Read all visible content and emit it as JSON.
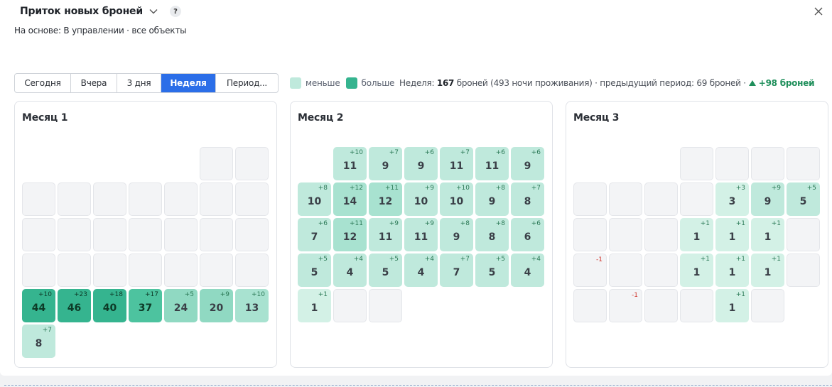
{
  "header": {
    "title": "Приток новых броней",
    "help_label": "?",
    "subtitle": "На основе: В управлении · все объекты"
  },
  "periods": [
    "Сегодня",
    "Вчера",
    "3 дня",
    "Неделя",
    "Период..."
  ],
  "active_period": "Неделя",
  "legend": {
    "less_label": "меньше",
    "more_label": "больше"
  },
  "summary": {
    "prefix": "Неделя: ",
    "bookings": "167",
    "bookings_suffix": " броней (493 ночи проживания) · предыдущий период: 69 броней ·",
    "growth": "+98 броней"
  },
  "colors": {
    "accent": "#2b6ee8",
    "scale": [
      "#d3f1e6",
      "#bfe9dc",
      "#a8e2d0",
      "#90d9c2",
      "#6fcfb0",
      "#4dc39f",
      "#35b48f"
    ],
    "negative": "#d0352d",
    "positive": "#1f8f5b"
  },
  "months": [
    {
      "title": "Месяц 1",
      "cells": [
        null,
        null,
        null,
        null,
        null,
        {
          "e": true
        },
        {
          "e": true
        },
        {
          "e": true
        },
        {
          "e": true
        },
        {
          "e": true
        },
        {
          "e": true
        },
        {
          "e": true
        },
        {
          "e": true
        },
        {
          "e": true
        },
        {
          "e": true
        },
        {
          "e": true
        },
        {
          "e": true
        },
        {
          "e": true
        },
        {
          "e": true
        },
        {
          "e": true
        },
        {
          "e": true
        },
        {
          "e": true
        },
        {
          "e": true
        },
        {
          "e": true
        },
        {
          "e": true
        },
        {
          "e": true
        },
        {
          "e": true
        },
        {
          "e": true
        },
        {
          "v": 44,
          "d": "+10"
        },
        {
          "v": 46,
          "d": "+23"
        },
        {
          "v": 40,
          "d": "+18"
        },
        {
          "v": 37,
          "d": "+17"
        },
        {
          "v": 24,
          "d": "+5"
        },
        {
          "v": 20,
          "d": "+9"
        },
        {
          "v": 13,
          "d": "+10"
        },
        {
          "v": 8,
          "d": "+7"
        }
      ]
    },
    {
      "title": "Месяц 2",
      "cells": [
        null,
        {
          "v": 11,
          "d": "+10"
        },
        {
          "v": 9,
          "d": "+7"
        },
        {
          "v": 9,
          "d": "+6"
        },
        {
          "v": 11,
          "d": "+7"
        },
        {
          "v": 11,
          "d": "+6"
        },
        {
          "v": 9,
          "d": "+6"
        },
        {
          "v": 10,
          "d": "+8"
        },
        {
          "v": 14,
          "d": "+12"
        },
        {
          "v": 12,
          "d": "+11"
        },
        {
          "v": 10,
          "d": "+9"
        },
        {
          "v": 10,
          "d": "+10"
        },
        {
          "v": 9,
          "d": "+8"
        },
        {
          "v": 8,
          "d": "+7"
        },
        {
          "v": 7,
          "d": "+6"
        },
        {
          "v": 12,
          "d": "+11"
        },
        {
          "v": 11,
          "d": "+9"
        },
        {
          "v": 11,
          "d": "+9"
        },
        {
          "v": 9,
          "d": "+8"
        },
        {
          "v": 8,
          "d": "+8"
        },
        {
          "v": 6,
          "d": "+6"
        },
        {
          "v": 5,
          "d": "+5"
        },
        {
          "v": 4,
          "d": "+4"
        },
        {
          "v": 5,
          "d": "+5"
        },
        {
          "v": 4,
          "d": "+4"
        },
        {
          "v": 7,
          "d": "+7"
        },
        {
          "v": 5,
          "d": "+5"
        },
        {
          "v": 4,
          "d": "+4"
        },
        {
          "v": 1,
          "d": "+1"
        },
        {
          "e": true
        },
        {
          "e": true
        }
      ]
    },
    {
      "title": "Месяц 3",
      "cells": [
        null,
        null,
        null,
        {
          "e": true
        },
        {
          "e": true
        },
        {
          "e": true
        },
        {
          "e": true
        },
        {
          "e": true
        },
        {
          "e": true
        },
        {
          "e": true
        },
        {
          "e": true
        },
        {
          "v": 3,
          "d": "+3"
        },
        {
          "v": 9,
          "d": "+9"
        },
        {
          "v": 5,
          "d": "+5"
        },
        {
          "e": true
        },
        {
          "e": true
        },
        {
          "e": true
        },
        {
          "v": 1,
          "d": "+1"
        },
        {
          "v": 1,
          "d": "+1"
        },
        {
          "v": 1,
          "d": "+1"
        },
        {
          "e": true
        },
        {
          "e": true,
          "d": "-1"
        },
        {
          "e": true
        },
        {
          "e": true
        },
        {
          "v": 1,
          "d": "+1"
        },
        {
          "v": 1,
          "d": "+1"
        },
        {
          "v": 1,
          "d": "+1"
        },
        {
          "e": true
        },
        {
          "e": true
        },
        {
          "e": true,
          "d": "-1"
        },
        {
          "e": true
        },
        {
          "e": true
        },
        {
          "v": 1,
          "d": "+1"
        },
        {
          "e": true
        }
      ]
    }
  ]
}
